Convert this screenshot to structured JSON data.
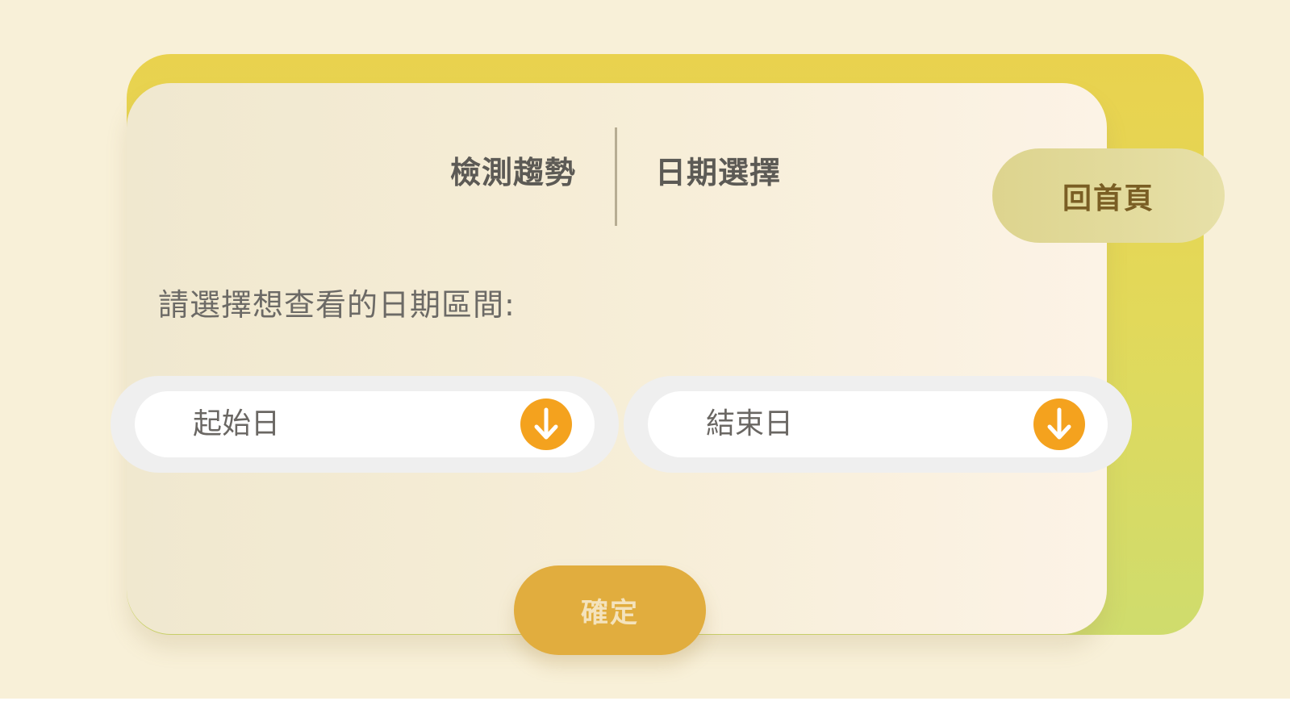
{
  "header": {
    "left_title": "檢測趨勢",
    "right_title": "日期選擇"
  },
  "home_button": {
    "label": "回首頁"
  },
  "form": {
    "prompt": "請選擇想查看的日期區間:",
    "start_date": {
      "placeholder": "起始日",
      "icon": "arrow-down-icon"
    },
    "end_date": {
      "placeholder": "結束日",
      "icon": "arrow-down-icon"
    },
    "confirm_label": "確定"
  },
  "colors": {
    "background": "#f8f0d8",
    "card_back_top": "#e9d24e",
    "card_back_bottom": "#cfdc6d",
    "card_front": "#f7eed8",
    "accent_orange": "#f4a21e",
    "confirm_button": "#e1ad3e",
    "home_button": "#e2da9a"
  }
}
